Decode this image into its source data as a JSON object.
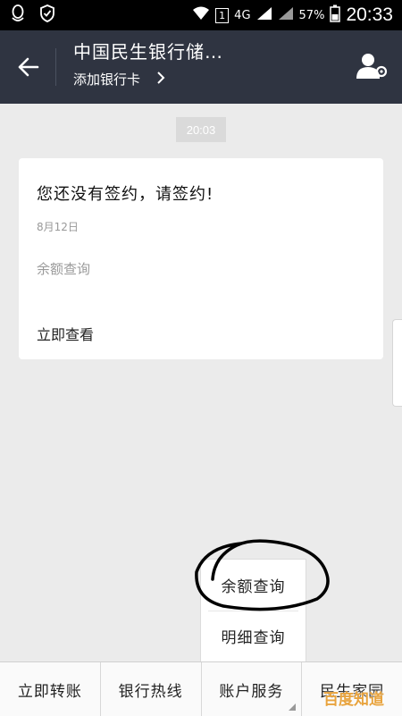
{
  "status_bar": {
    "network": "4G",
    "sim_slot": "1",
    "battery": "57%",
    "time": "20:33"
  },
  "header": {
    "title": "中国民生银行储…",
    "subtitle": "添加银行卡"
  },
  "chat": {
    "timestamp": "20:03",
    "card": {
      "title": "您还没有签约，请签约!",
      "date": "8月12日",
      "balance_link": "余额查询",
      "view_link": "立即查看"
    }
  },
  "popup_menu": {
    "items": [
      "余额查询",
      "明细查询"
    ]
  },
  "bottom_tabs": [
    "立即转账",
    "银行热线",
    "账户服务",
    "民生家园"
  ],
  "watermark": "百度知道",
  "colors": {
    "header_bg": "#2f3441",
    "page_bg": "#ebebeb",
    "watermark": "#e8a33d"
  }
}
